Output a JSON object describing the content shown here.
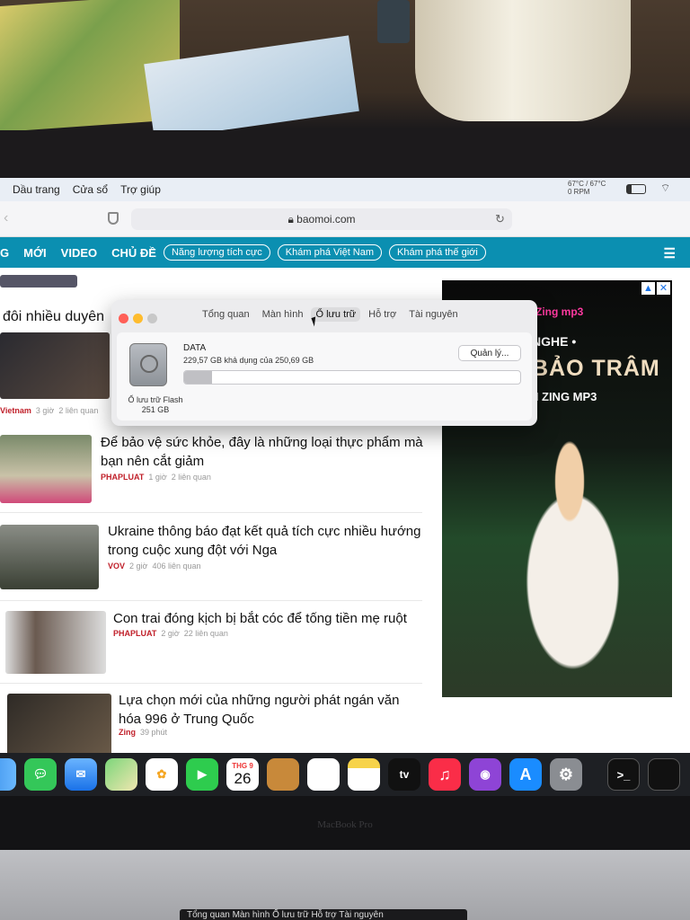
{
  "menubar": {
    "items": [
      "Dầu trang",
      "Cửa sổ",
      "Trợ giúp"
    ],
    "temp": "67°C / 67°C",
    "rpm": "0 RPM"
  },
  "browser": {
    "url": "baomoi.com"
  },
  "nav": {
    "items": [
      "G",
      "MỚI",
      "VIDEO",
      "CHỦ ĐỀ"
    ],
    "pills": [
      "Năng lượng tích cực",
      "Khám phá Việt Nam",
      "Khám phá thế giới"
    ]
  },
  "content": {
    "section_partial": "đôi nhiều duyên",
    "top_meta": {
      "source": "Vietnam",
      "time": "3 giờ",
      "related": "2 liên quan"
    },
    "articles": [
      {
        "title": "Để bảo vệ sức khỏe, đây là những loại thực phẩm mà bạn nên cắt giảm",
        "source": "PHAPLUAT",
        "time": "1 giờ",
        "related": "2 liên quan"
      },
      {
        "title": "Ukraine thông báo đạt kết quả tích cực nhiều hướng trong cuộc xung đột với Nga",
        "source": "VOV",
        "time": "2 giờ",
        "related": "406 liên quan"
      },
      {
        "title": "Con trai đóng kịch bị bắt cóc để tống tiền mẹ ruột",
        "source": "PHAPLUAT",
        "time": "2 giờ",
        "related": "22 liên quan"
      },
      {
        "title": "Lựa chọn mới của những người phát ngán văn hóa 996 ở Trung Quốc",
        "source": "Zing",
        "time": "39 phút",
        "related": ""
      }
    ]
  },
  "ad": {
    "brand": "Zing mp3",
    "line1": "NGHE •",
    "line2": "BẢO TRÂM",
    "line3": "N ZING MP3"
  },
  "prefs": {
    "tabs": [
      "Tổng quan",
      "Màn hình",
      "Ổ lưu trữ",
      "Hỗ trợ",
      "Tài nguyên"
    ],
    "selected_tab": 2,
    "disk_name": "DATA",
    "disk_free": "229,57 GB khả dụng của 250,69 GB",
    "manage_label": "Quản lý...",
    "disk_type": "Ổ lưu trữ Flash",
    "disk_size": "251 GB",
    "used_fraction": 0.084
  },
  "dock": {
    "calendar_month": "THG 9",
    "calendar_day": "26",
    "tv_label": "tv",
    "icons": [
      "finder-icon",
      "messages-icon",
      "mail-icon",
      "maps-icon",
      "photos-icon",
      "facetime-icon",
      "calendar-icon",
      "contacts-icon",
      "reminders-icon",
      "notes-icon",
      "appletv-icon",
      "music-icon",
      "podcasts-icon",
      "appstore-icon",
      "systemprefs-icon",
      "terminal-icon",
      "terminal2-icon"
    ]
  },
  "laptop": {
    "brand": "MacBook Pro",
    "touchbar": "Tổng quan   Màn hình   Ổ lưu trữ   Hỗ trợ   Tài nguyên"
  }
}
